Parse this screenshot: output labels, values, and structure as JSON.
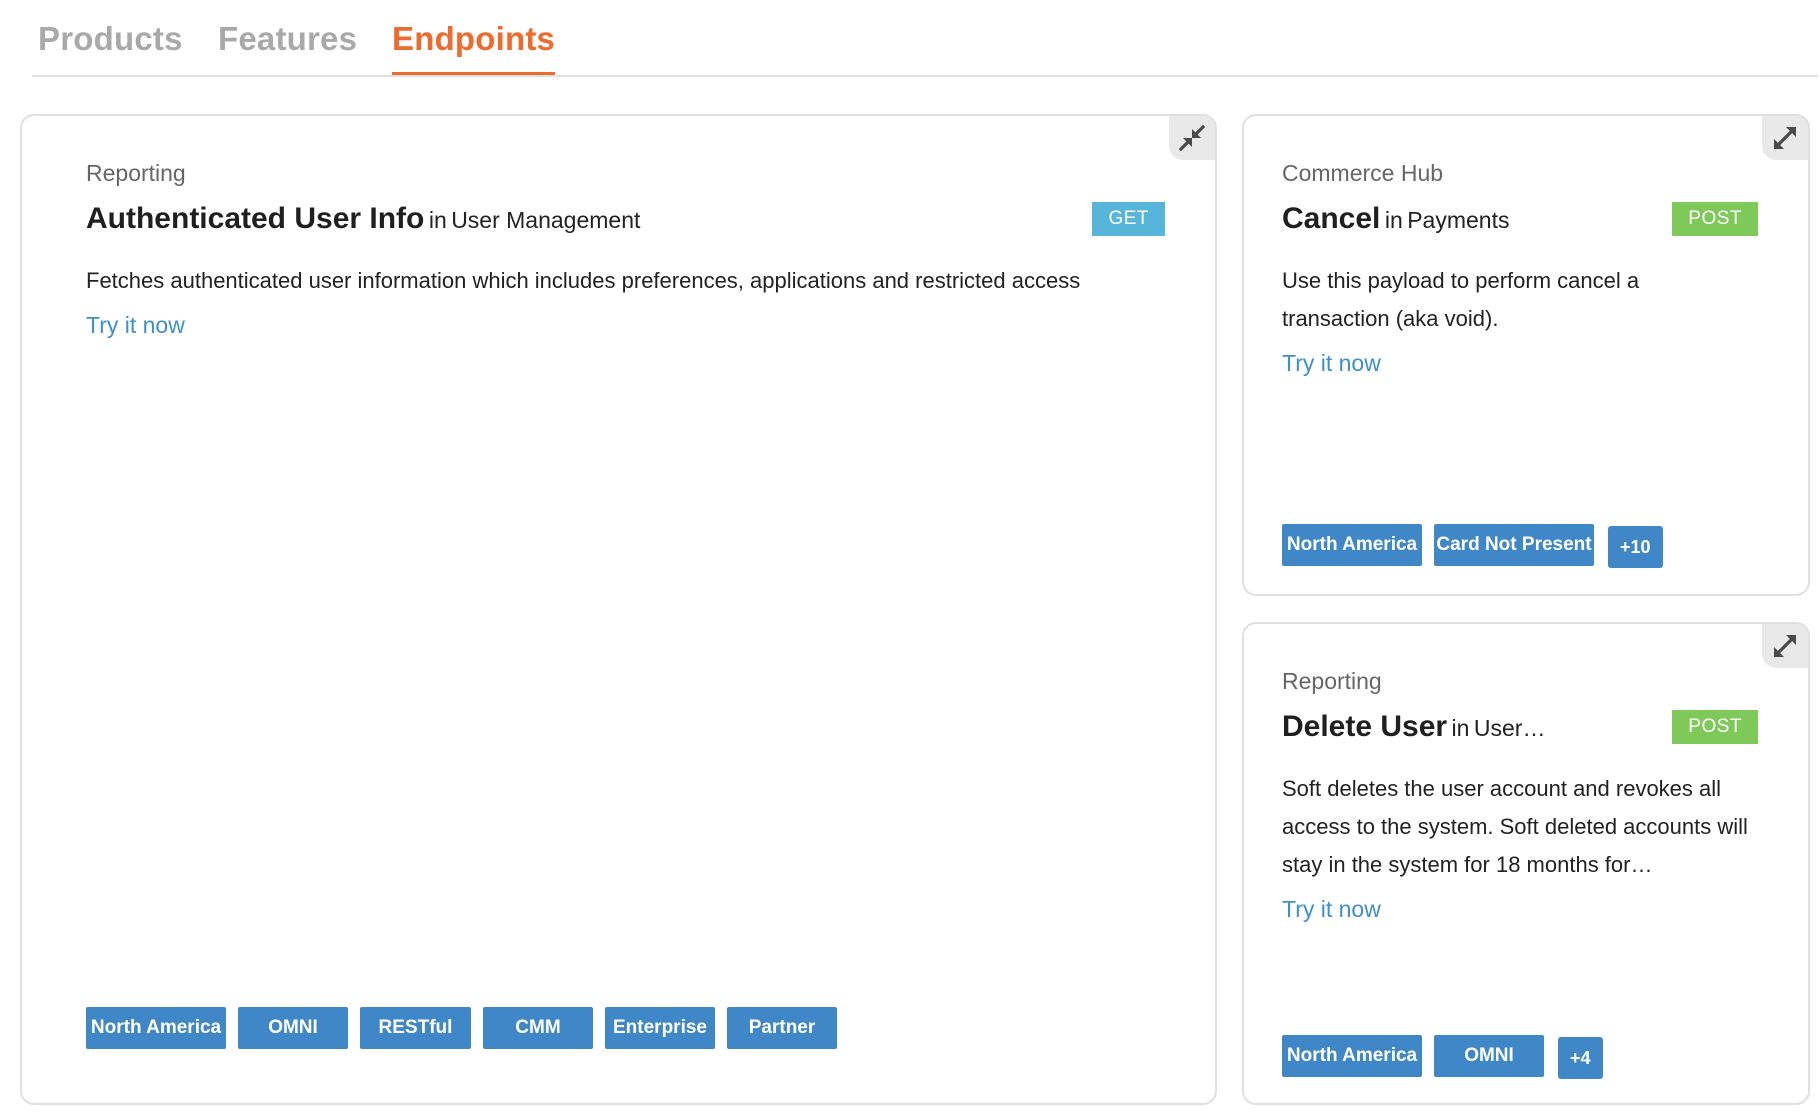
{
  "tabs": [
    {
      "label": "Products",
      "active": false
    },
    {
      "label": "Features",
      "active": false
    },
    {
      "label": "Endpoints",
      "active": true
    }
  ],
  "colors": {
    "accent": "#ec6b2d",
    "tab_inactive": "#a9a9a9",
    "tag_blue": "#3f87c7",
    "get_badge": "#57b5d9",
    "post_badge": "#7fc95b",
    "link": "#3f8fcb"
  },
  "cards": [
    {
      "category": "Reporting",
      "title": "Authenticated User Info",
      "in_word": "in",
      "group": "User Management",
      "method": "GET",
      "description": "Fetches authenticated user information which includes preferences, applications and restricted access",
      "try_label": "Try it now",
      "toggle_icon": "collapse-icon",
      "tags": [
        "North America",
        "OMNI",
        "RESTful",
        "CMM",
        "Enterprise",
        "Partner"
      ]
    },
    {
      "category": "Commerce Hub",
      "title": "Cancel",
      "in_word": "in",
      "group": "Payments",
      "method": "POST",
      "description": "Use this payload to perform cancel a transaction (aka void).",
      "try_label": "Try it now",
      "toggle_icon": "expand-icon",
      "tags": [
        "North America",
        "Card Not Present"
      ],
      "more": "+10"
    },
    {
      "category": "Reporting",
      "title": "Delete User",
      "in_word": "in",
      "group": "User…",
      "method": "POST",
      "description": "Soft deletes the user account and revokes all access to the system. Soft deleted accounts will stay in the system for 18 months for…",
      "try_label": "Try it now",
      "toggle_icon": "expand-icon",
      "tags": [
        "North America",
        "OMNI"
      ],
      "more": "+4"
    }
  ]
}
